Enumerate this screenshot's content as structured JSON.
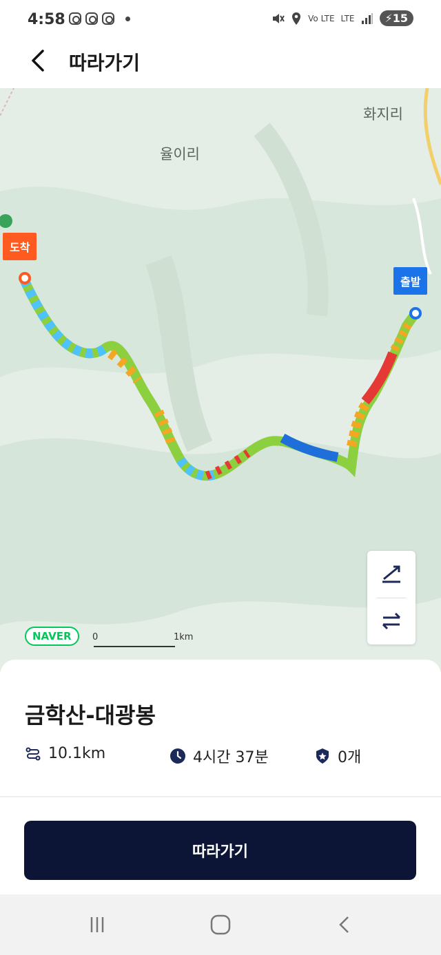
{
  "status_bar": {
    "time": "4:58",
    "network": "LTE",
    "volte": "Vo LTE",
    "battery": "15"
  },
  "header": {
    "title": "따라가기"
  },
  "map": {
    "places": [
      "율이리",
      "화지리"
    ],
    "arrival_label": "도착",
    "departure_label": "출발",
    "attribution": "NAVER",
    "scale_start": "0",
    "scale_end": "1km"
  },
  "course": {
    "name": "금학산-대광봉",
    "distance": "10.1km",
    "duration": "4시간 37분",
    "badges": "0개"
  },
  "action": {
    "follow_label": "따라가기"
  },
  "colors": {
    "accent": "#0c1535",
    "arrival": "#ff5a1f",
    "departure": "#1a73e8",
    "naver": "#03c75a"
  }
}
